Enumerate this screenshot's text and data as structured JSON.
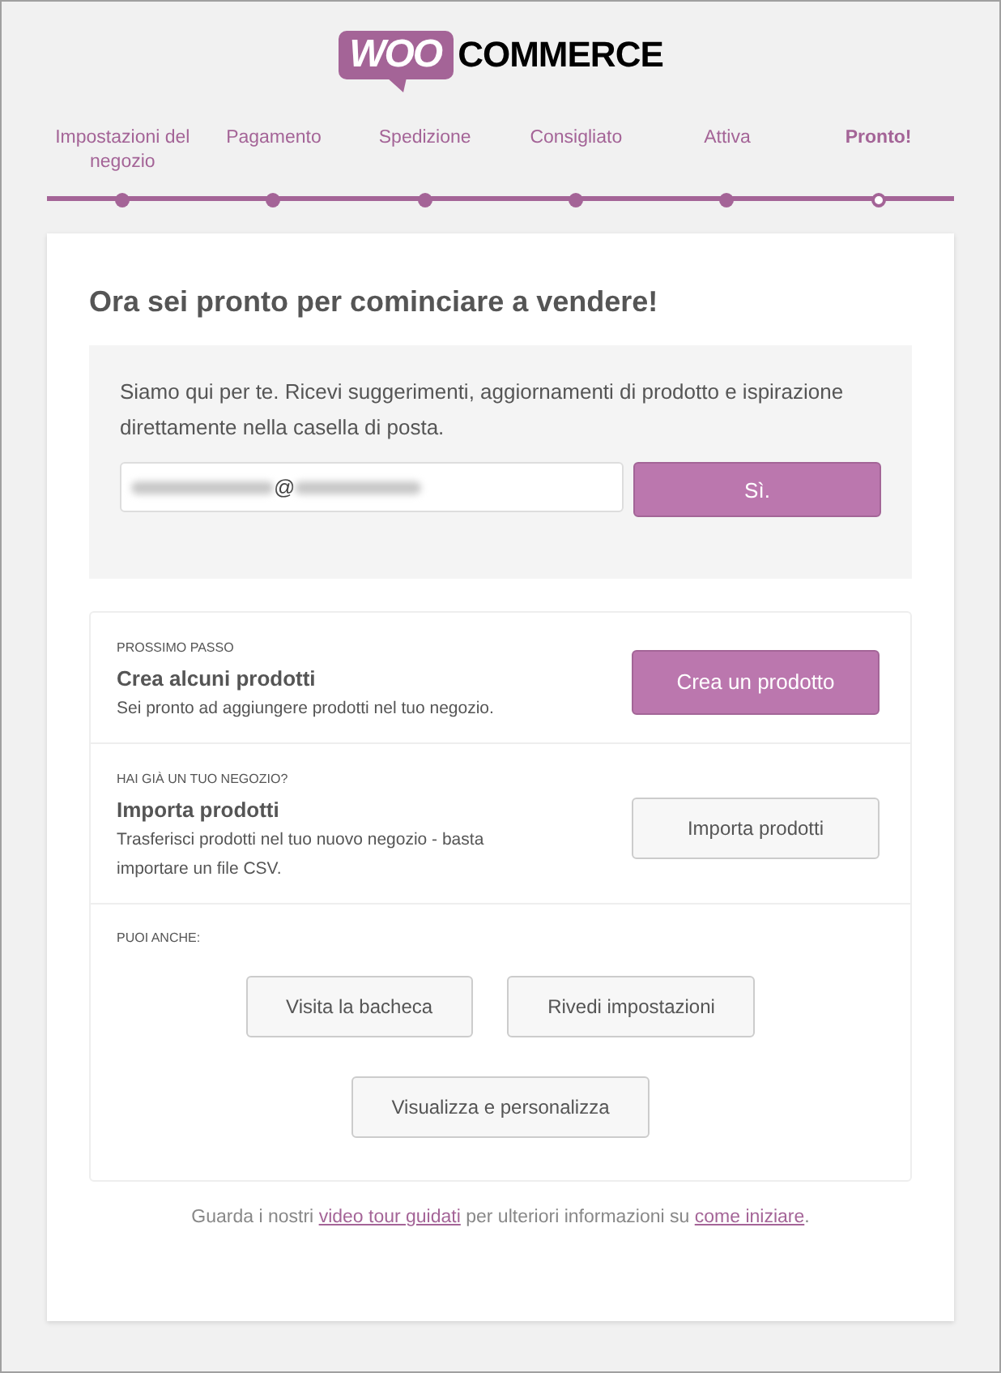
{
  "logo": {
    "badge": "WOO",
    "text": "COMMERCE"
  },
  "steps": [
    {
      "label": "Impostazioni del negozio",
      "selected": false
    },
    {
      "label": "Pagamento",
      "selected": false
    },
    {
      "label": "Spedizione",
      "selected": false
    },
    {
      "label": "Consigliato",
      "selected": false
    },
    {
      "label": "Attiva",
      "selected": false
    },
    {
      "label": "Pronto!",
      "selected": true
    }
  ],
  "title": "Ora sei pronto per cominciare a vendere!",
  "newsletter": {
    "text": "Siamo qui per te. Ricevi suggerimenti, aggiornamenti di prodotto e ispirazione direttamente nella casella di posta.",
    "email_visible": "@",
    "button": "Sì."
  },
  "next_steps": [
    {
      "kind": "primary",
      "eyebrow": "PROSSIMO PASSO",
      "heading": "Crea alcuni prodotti",
      "description": "Sei pronto ad aggiungere prodotti nel tuo negozio.",
      "button": "Crea un prodotto"
    },
    {
      "kind": "secondary",
      "eyebrow": "HAI GIÀ UN TUO NEGOZIO?",
      "heading": "Importa prodotti",
      "description": "Trasferisci prodotti nel tuo nuovo negozio - basta importare un file CSV.",
      "button": "Importa prodotti"
    }
  ],
  "more": {
    "eyebrow": "PUOI ANCHE:",
    "buttons": [
      "Visita la bacheca",
      "Rivedi impostazioni",
      "Visualizza e personalizza"
    ]
  },
  "footer": [
    {
      "kind": "text",
      "text": "Guarda i nostri"
    },
    {
      "kind": "link",
      "text": "video tour guidati"
    },
    {
      "kind": "text",
      "text": "per ulteriori informazioni su"
    },
    {
      "kind": "link",
      "text": "come iniziare"
    },
    {
      "kind": "text",
      "text": "."
    }
  ]
}
